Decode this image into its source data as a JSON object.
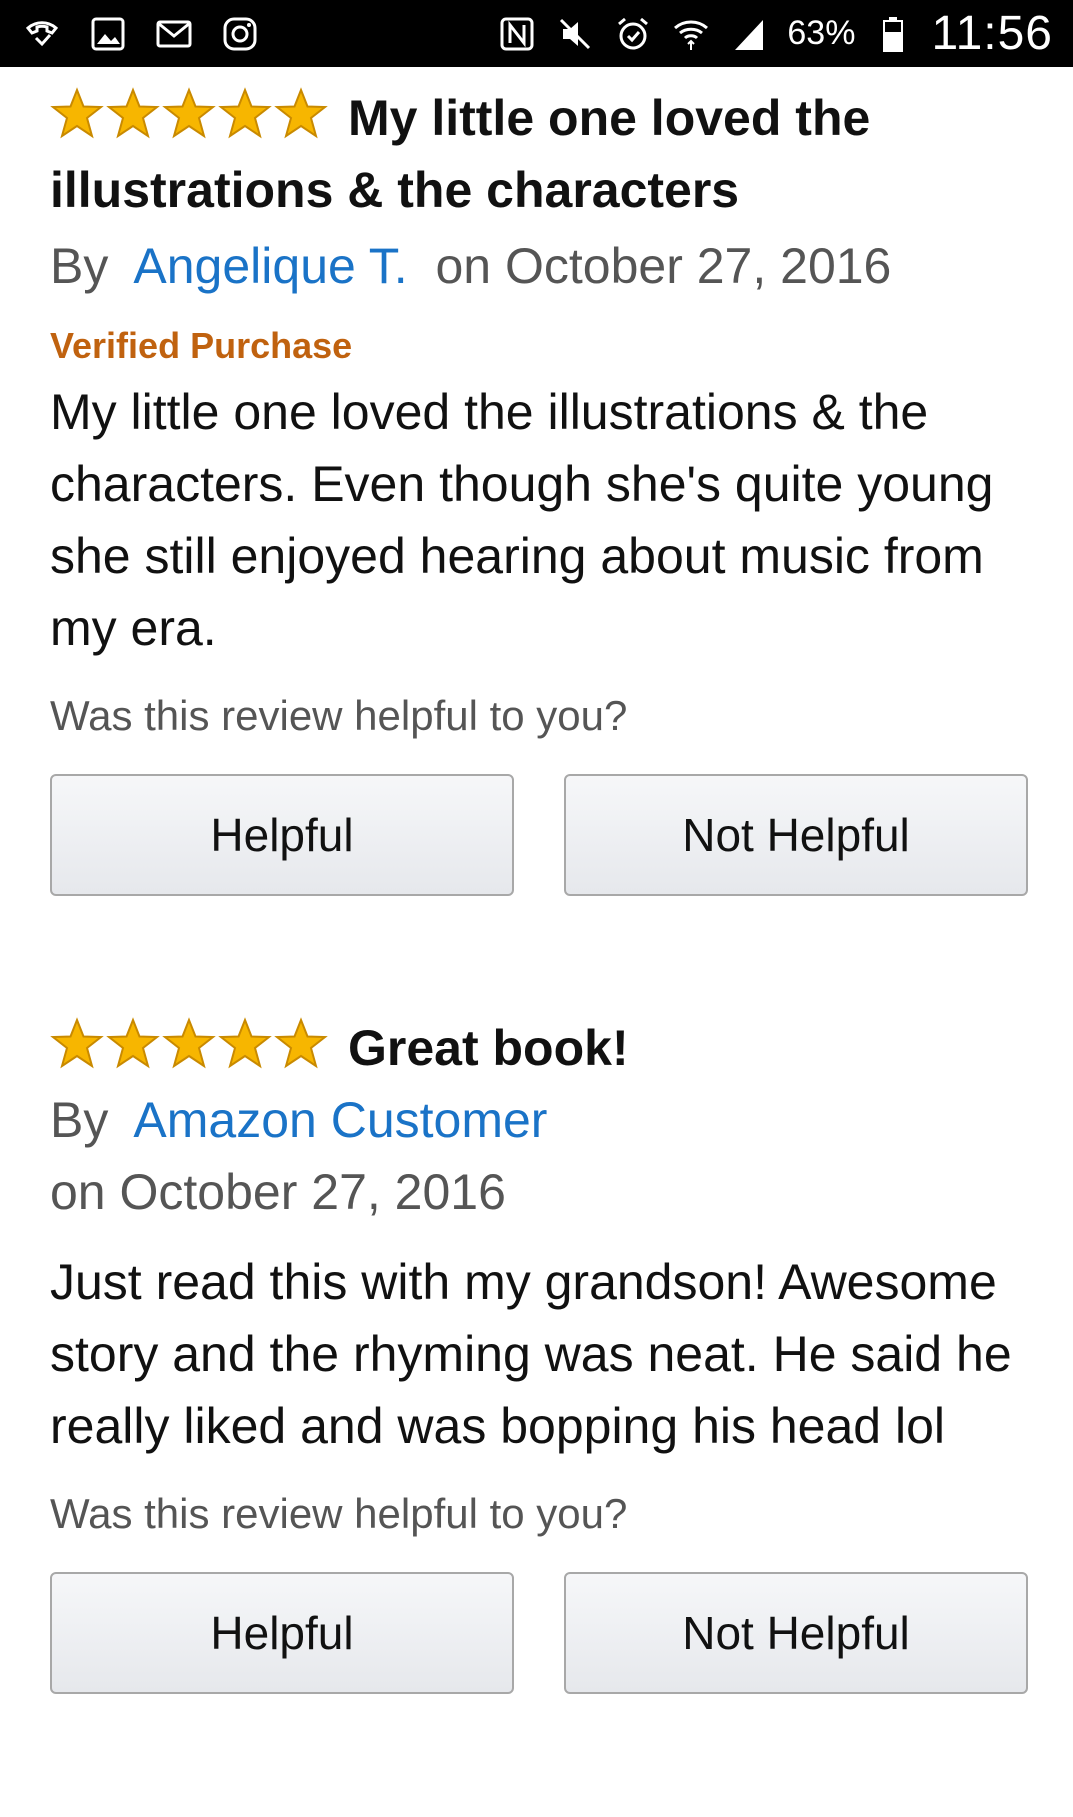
{
  "status_bar": {
    "left_icons": [
      "missed-call-icon",
      "gallery-icon",
      "gmail-icon",
      "instagram-icon"
    ],
    "right_icons": [
      "nfc-icon",
      "mute-icon",
      "alarm-icon",
      "wifi-icon",
      "signal-icon",
      "battery-icon"
    ],
    "battery_percent": "63%",
    "time": "11:56"
  },
  "reviews": [
    {
      "rating": 5,
      "title": "My little one loved the illustrations & the characters",
      "by_label": "By",
      "author": "Angelique T.",
      "date": "on October 27, 2016",
      "verified": "Verified Purchase",
      "body": "My little one loved the illustrations & the characters. Even though she's quite young she still enjoyed hearing about music from my era.",
      "helpful_question": "Was this review helpful to you?",
      "helpful_label": "Helpful",
      "not_helpful_label": "Not Helpful"
    },
    {
      "rating": 5,
      "title": "Great book!",
      "by_label": "By",
      "author": "Amazon Customer",
      "date": "on October 27, 2016",
      "body": "Just read this with my grandson! Awesome story and the rhyming was neat. He said he really liked and was bopping his head lol",
      "helpful_question": "Was this review helpful to you?",
      "helpful_label": "Helpful",
      "not_helpful_label": "Not Helpful"
    }
  ],
  "colors": {
    "star_fill": "#f7b600",
    "star_stroke": "#c98a00",
    "author_link": "#1a73c7",
    "verified": "#c0620f"
  }
}
